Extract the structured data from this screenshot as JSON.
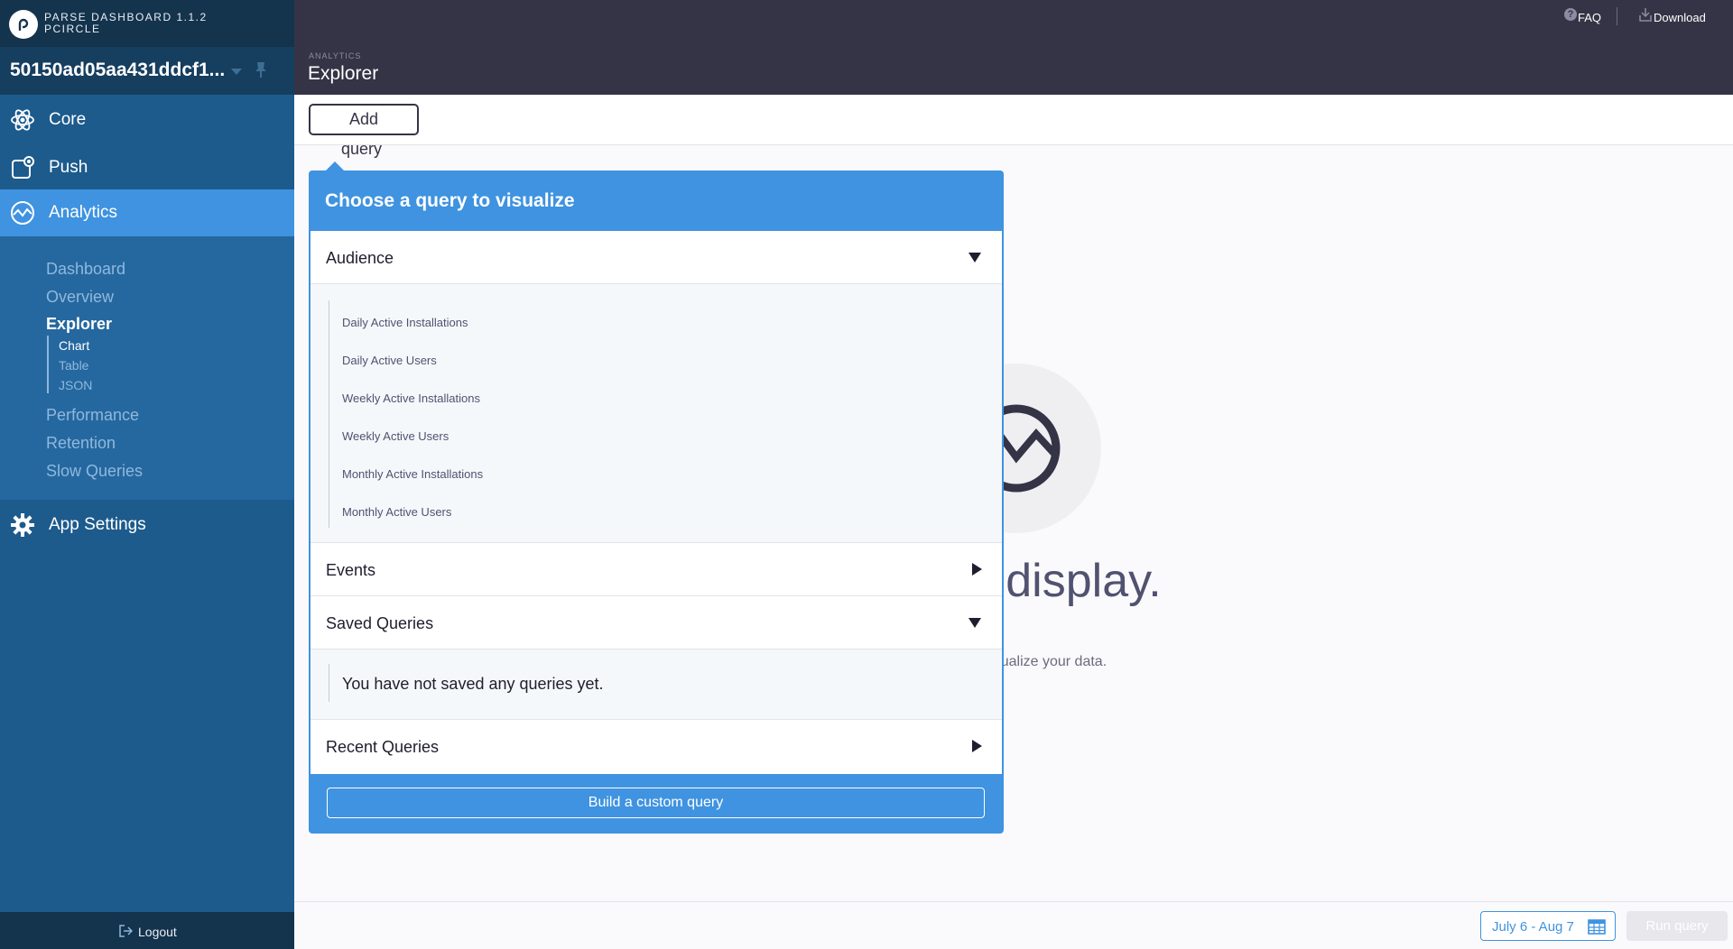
{
  "brand": {
    "line1": "PARSE DASHBOARD 1.1.2",
    "line2": "PCIRCLE"
  },
  "app": {
    "name": "50150ad05aa431ddcf1..."
  },
  "sidebar": {
    "nav": [
      {
        "label": "Core",
        "icon": "atom-icon"
      },
      {
        "label": "Push",
        "icon": "push-icon"
      },
      {
        "label": "Analytics",
        "icon": "analytics-icon"
      },
      {
        "label": "App Settings",
        "icon": "gear-icon"
      }
    ],
    "analytics_sub": [
      "Dashboard",
      "Overview",
      "Explorer",
      "Performance",
      "Retention",
      "Slow Queries"
    ],
    "explorer_sub": [
      "Chart",
      "Table",
      "JSON"
    ],
    "logout": "Logout"
  },
  "header": {
    "section": "ANALYTICS",
    "title": "Explorer",
    "faq": "FAQ",
    "download": "Download"
  },
  "toolbar": {
    "add_query_line1": "Add",
    "add_query_line2": "query"
  },
  "empty_state": {
    "title": "s to display.",
    "subtitle": "n above to visualize your data."
  },
  "popover": {
    "title": "Choose a query to visualize",
    "groups": [
      {
        "label": "Audience",
        "expanded": true,
        "items": [
          "Daily Active Installations",
          "Daily Active Users",
          "Weekly Active Installations",
          "Weekly Active Users",
          "Monthly Active Installations",
          "Monthly Active Users"
        ]
      },
      {
        "label": "Events",
        "expanded": false
      },
      {
        "label": "Saved Queries",
        "expanded": true,
        "empty": "You have not saved any queries yet."
      },
      {
        "label": "Recent Queries",
        "expanded": false
      }
    ],
    "build_custom": "Build a custom query"
  },
  "footer": {
    "date_range": "July 6 - Aug 7",
    "run_query": "Run query"
  },
  "colors": {
    "accent": "#3f93e0",
    "sidebar": "#1d5b8d",
    "header": "#353446"
  }
}
